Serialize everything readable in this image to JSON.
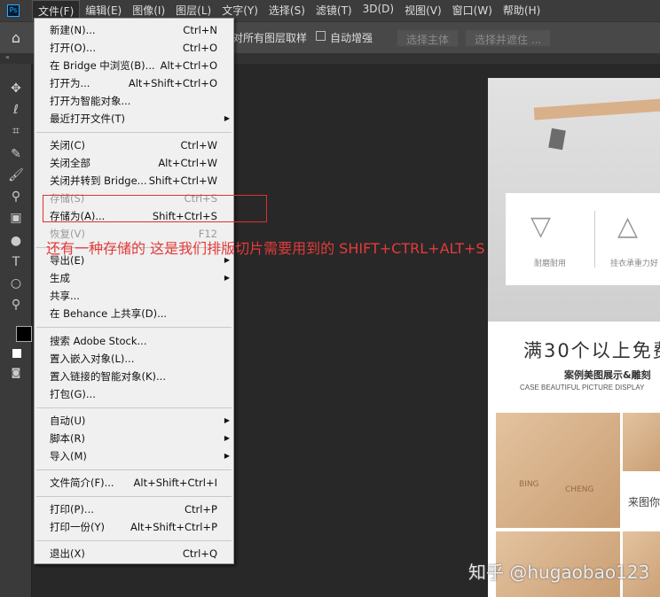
{
  "menubar": {
    "logo": "Ps",
    "items": [
      "文件(F)",
      "编辑(E)",
      "图像(I)",
      "图层(L)",
      "文字(Y)",
      "选择(S)",
      "滤镜(T)",
      "3D(D)",
      "视图(V)",
      "窗口(W)",
      "帮助(H)"
    ]
  },
  "options": {
    "sample_all": "对所有图层取样",
    "auto_enhance": "自动增强",
    "select_subject": "选择主体",
    "select_mask": "选择并遮住 ..."
  },
  "tabbar": {
    "collapse": "«"
  },
  "file_menu": [
    {
      "label": "新建(N)...",
      "shortcut": "Ctrl+N"
    },
    {
      "label": "打开(O)...",
      "shortcut": "Ctrl+O"
    },
    {
      "label": "在 Bridge 中浏览(B)...",
      "shortcut": "Alt+Ctrl+O"
    },
    {
      "label": "打开为...",
      "shortcut": "Alt+Shift+Ctrl+O"
    },
    {
      "label": "打开为智能对象...",
      "shortcut": ""
    },
    {
      "label": "最近打开文件(T)",
      "shortcut": "",
      "submenu": true
    },
    {
      "sep": true
    },
    {
      "label": "关闭(C)",
      "shortcut": "Ctrl+W"
    },
    {
      "label": "关闭全部",
      "shortcut": "Alt+Ctrl+W"
    },
    {
      "label": "关闭并转到 Bridge...",
      "shortcut": "Shift+Ctrl+W"
    },
    {
      "label": "存储(S)",
      "shortcut": "Ctrl+S",
      "disabled": true
    },
    {
      "label": "存储为(A)...",
      "shortcut": "Shift+Ctrl+S"
    },
    {
      "label": "恢复(V)",
      "shortcut": "F12",
      "disabled": true
    },
    {
      "sep": true
    },
    {
      "label": "导出(E)",
      "shortcut": "",
      "submenu": true
    },
    {
      "label": "生成",
      "shortcut": "",
      "submenu": true
    },
    {
      "label": "共享...",
      "shortcut": ""
    },
    {
      "label": "在 Behance 上共享(D)...",
      "shortcut": ""
    },
    {
      "sep": true
    },
    {
      "label": "搜索 Adobe Stock...",
      "shortcut": ""
    },
    {
      "label": "置入嵌入对象(L)...",
      "shortcut": ""
    },
    {
      "label": "置入链接的智能对象(K)...",
      "shortcut": ""
    },
    {
      "label": "打包(G)...",
      "shortcut": ""
    },
    {
      "sep": true
    },
    {
      "label": "自动(U)",
      "shortcut": "",
      "submenu": true
    },
    {
      "label": "脚本(R)",
      "shortcut": "",
      "submenu": true
    },
    {
      "label": "导入(M)",
      "shortcut": "",
      "submenu": true
    },
    {
      "sep": true
    },
    {
      "label": "文件简介(F)...",
      "shortcut": "Alt+Shift+Ctrl+I"
    },
    {
      "sep": true
    },
    {
      "label": "打印(P)...",
      "shortcut": "Ctrl+P"
    },
    {
      "label": "打印一份(Y)",
      "shortcut": "Alt+Shift+Ctrl+P"
    },
    {
      "sep": true
    },
    {
      "label": "退出(X)",
      "shortcut": "Ctrl+Q"
    }
  ],
  "annotation": "还有一种存储的  这是我们排版切片需要用到的    SHIFT+CTRL+ALT+S",
  "document": {
    "feature1": "耐磨耐用",
    "feature2": "挂衣承重力好",
    "headline": "满30个以上免费",
    "subheadline": "案例美图展示&雕刻",
    "sub_en": "CASE BEAUTIFUL PICTURE DISPLAY",
    "engrave1": "BING",
    "engrave2": "CHENG",
    "side_text": "来图你"
  },
  "watermark": "知乎 @hugaobao123"
}
